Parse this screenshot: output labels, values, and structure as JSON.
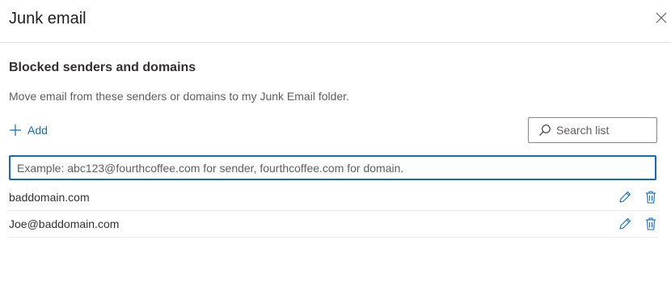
{
  "dialog": {
    "title": "Junk email",
    "close_icon": "close-icon"
  },
  "section": {
    "title": "Blocked senders and domains",
    "description": "Move email from these senders or domains to my Junk Email folder."
  },
  "toolbar": {
    "add_label": "Add",
    "add_icon": "plus-icon",
    "search_placeholder": "Search list",
    "search_icon": "search-icon"
  },
  "entry": {
    "placeholder": "Example: abc123@fourthcoffee.com for sender, fourthcoffee.com for domain.",
    "value": ""
  },
  "blocked_list": [
    {
      "label": "baddomain.com"
    },
    {
      "label": "Joe@baddomain.com"
    }
  ],
  "colors": {
    "accent": "#0f6cbd",
    "text": "#323130",
    "secondary_text": "#605e5c",
    "divider": "#e1dfdd"
  }
}
